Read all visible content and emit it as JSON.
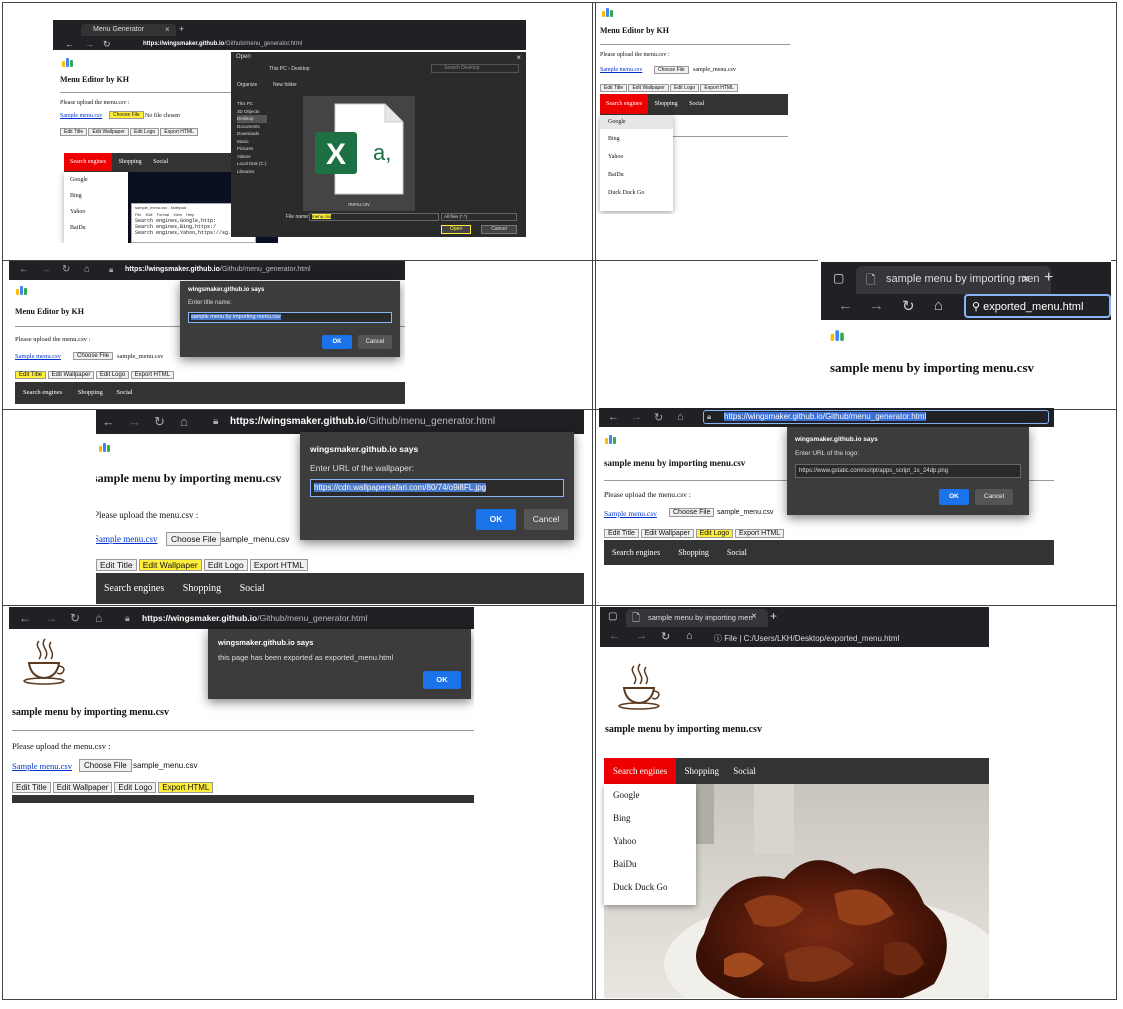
{
  "editor": {
    "title": "Menu Editor by KH",
    "new_title": "sample menu by importing menu.csv",
    "upload_prompt": "Please upload the menu.csv :",
    "sample_link": "Sample menu.csv",
    "choose_file": "Choose File",
    "no_file": "No file chosen",
    "file_name": "sample_menu.csv",
    "buttons": [
      "Edit Title",
      "Edit Wallpaper",
      "Edit Logo",
      "Export HTML"
    ],
    "nav": [
      "Search engines",
      "Shopping",
      "Social"
    ],
    "dropdown": [
      "Google",
      "Bing",
      "Yahoo",
      "BaiDu",
      "Duck Duck Go"
    ]
  },
  "browser": {
    "url_host": "https://wingsmaker.github.io",
    "url_path": "/Github/menu_generator.html",
    "url_full": "https://wingsmaker.github.io/Github/menu_generator.html",
    "tab_title": "Menu Generator",
    "exported_tab": "sample menu by importing men",
    "exported_search": "exported_menu.html",
    "file_label": "File",
    "local_path": "C:/Users/LKH/Desktop/exported_menu.html"
  },
  "open_dialog": {
    "title": "Open",
    "breadcrumb": [
      "This PC",
      "Desktop"
    ],
    "search_placeholder": "Search Desktop",
    "organize": "Organize",
    "new_folder": "New folder",
    "tree": [
      "This PC",
      "3D Objects",
      "Desktop",
      "Documents",
      "Downloads",
      "Music",
      "Pictures",
      "Videos",
      "Local Disk (C:)",
      "Libraries"
    ],
    "file": "menu.csv",
    "file_name_label": "File name:",
    "file_name_value": "menu.csv",
    "filter": "All files (*.*)",
    "open": "Open",
    "cancel": "Cancel"
  },
  "notepad": {
    "title": "sample_menu.csv - Notepad",
    "menu": [
      "File",
      "Edit",
      "Format",
      "View",
      "Help"
    ],
    "lines": [
      "Search engines,Google,http:",
      "Search engines,Bing,https:/",
      "Search engines,Yahoo,https://sg.yahoo.com/"
    ]
  },
  "dialogs": {
    "site": "wingsmaker.github.io says",
    "title_prompt": "Enter title name:",
    "title_value": "sample menu by importing menu.csv",
    "wallpaper_prompt": "Enter URL of the wallpaper:",
    "wallpaper_value": "https://cdn.wallpapersafari.com/80/74/o9i8FL.jpg",
    "logo_prompt": "Enter URL of the logo:",
    "logo_value": "https://www.gstatic.com/script/apps_script_1x_24dp.png",
    "export_message": "this page has been exported as exported_menu.html",
    "ok": "OK",
    "cancel": "Cancel"
  },
  "icons": [
    "back-arrow-icon",
    "forward-arrow-icon",
    "refresh-icon",
    "home-icon",
    "lock-icon",
    "info-icon",
    "search-icon",
    "tab-icon",
    "close-icon",
    "plus-icon",
    "excel-icon",
    "folder-icon",
    "coffee-cup-icon",
    "apps-script-logo-icon"
  ],
  "colors": {
    "accent_red": "#e00000",
    "highlight": "#ffef3a",
    "dialog_bg": "#3c3c3c",
    "ok_blue": "#1a73e8",
    "navbar": "#333333"
  }
}
